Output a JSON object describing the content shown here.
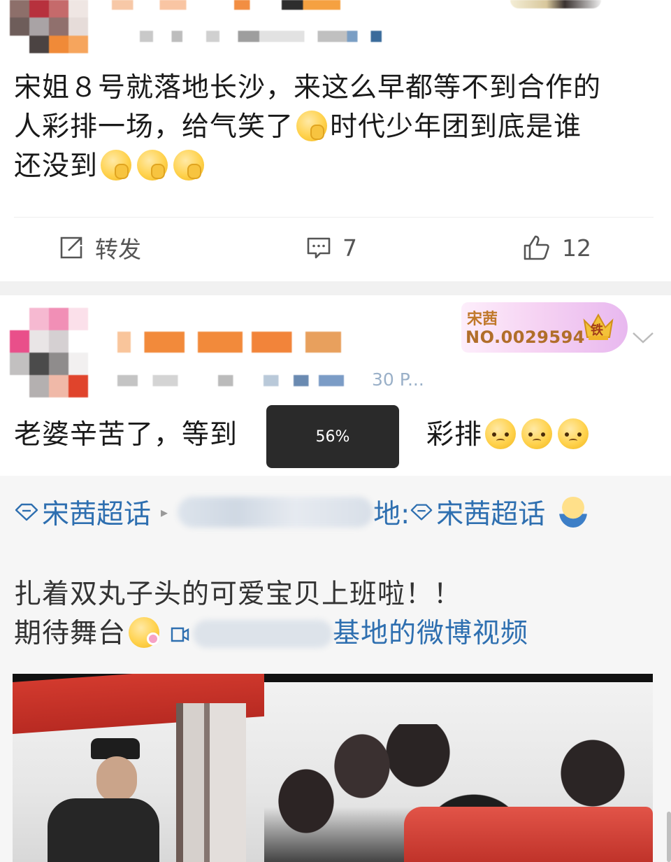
{
  "post1": {
    "text_line1": "宋姐８号就落地长沙，来这么早都等不到合作的",
    "text_line2a": "人彩排一场，给气笑了",
    "text_line2b": "时代少年团到底是谁",
    "text_line3": "还没到",
    "actions": {
      "repost_label": "转发",
      "comment_count": "7",
      "like_count": "12"
    }
  },
  "post2": {
    "badge": {
      "title": "宋茜",
      "number": "NO.0029594",
      "crown_text": "铁"
    },
    "meta_suffix": "30 P...",
    "text_a": "老婆辛苦了，等到",
    "text_b": "彩排"
  },
  "toast": {
    "text": "56%"
  },
  "repost": {
    "topic1": "宋茜超话",
    "topic_sep": "▸",
    "via_suffix": "地:",
    "topic2": "宋茜超话",
    "body_line1": "扎着双丸子头的可爱宝贝上班啦！！",
    "body_line2": "期待舞台",
    "video_link_suffix": "基地的微博视频"
  },
  "icons": {
    "repost": "repost-icon",
    "comment": "comment-icon",
    "like": "thumbs-up-icon",
    "chevron": "chevron-down-icon",
    "topic": "diamond-topic-icon"
  },
  "colors": {
    "link": "#2e6fb0",
    "badge_bg": "#f3c7f0",
    "badge_text": "#c0782a",
    "divider": "#efefef"
  }
}
